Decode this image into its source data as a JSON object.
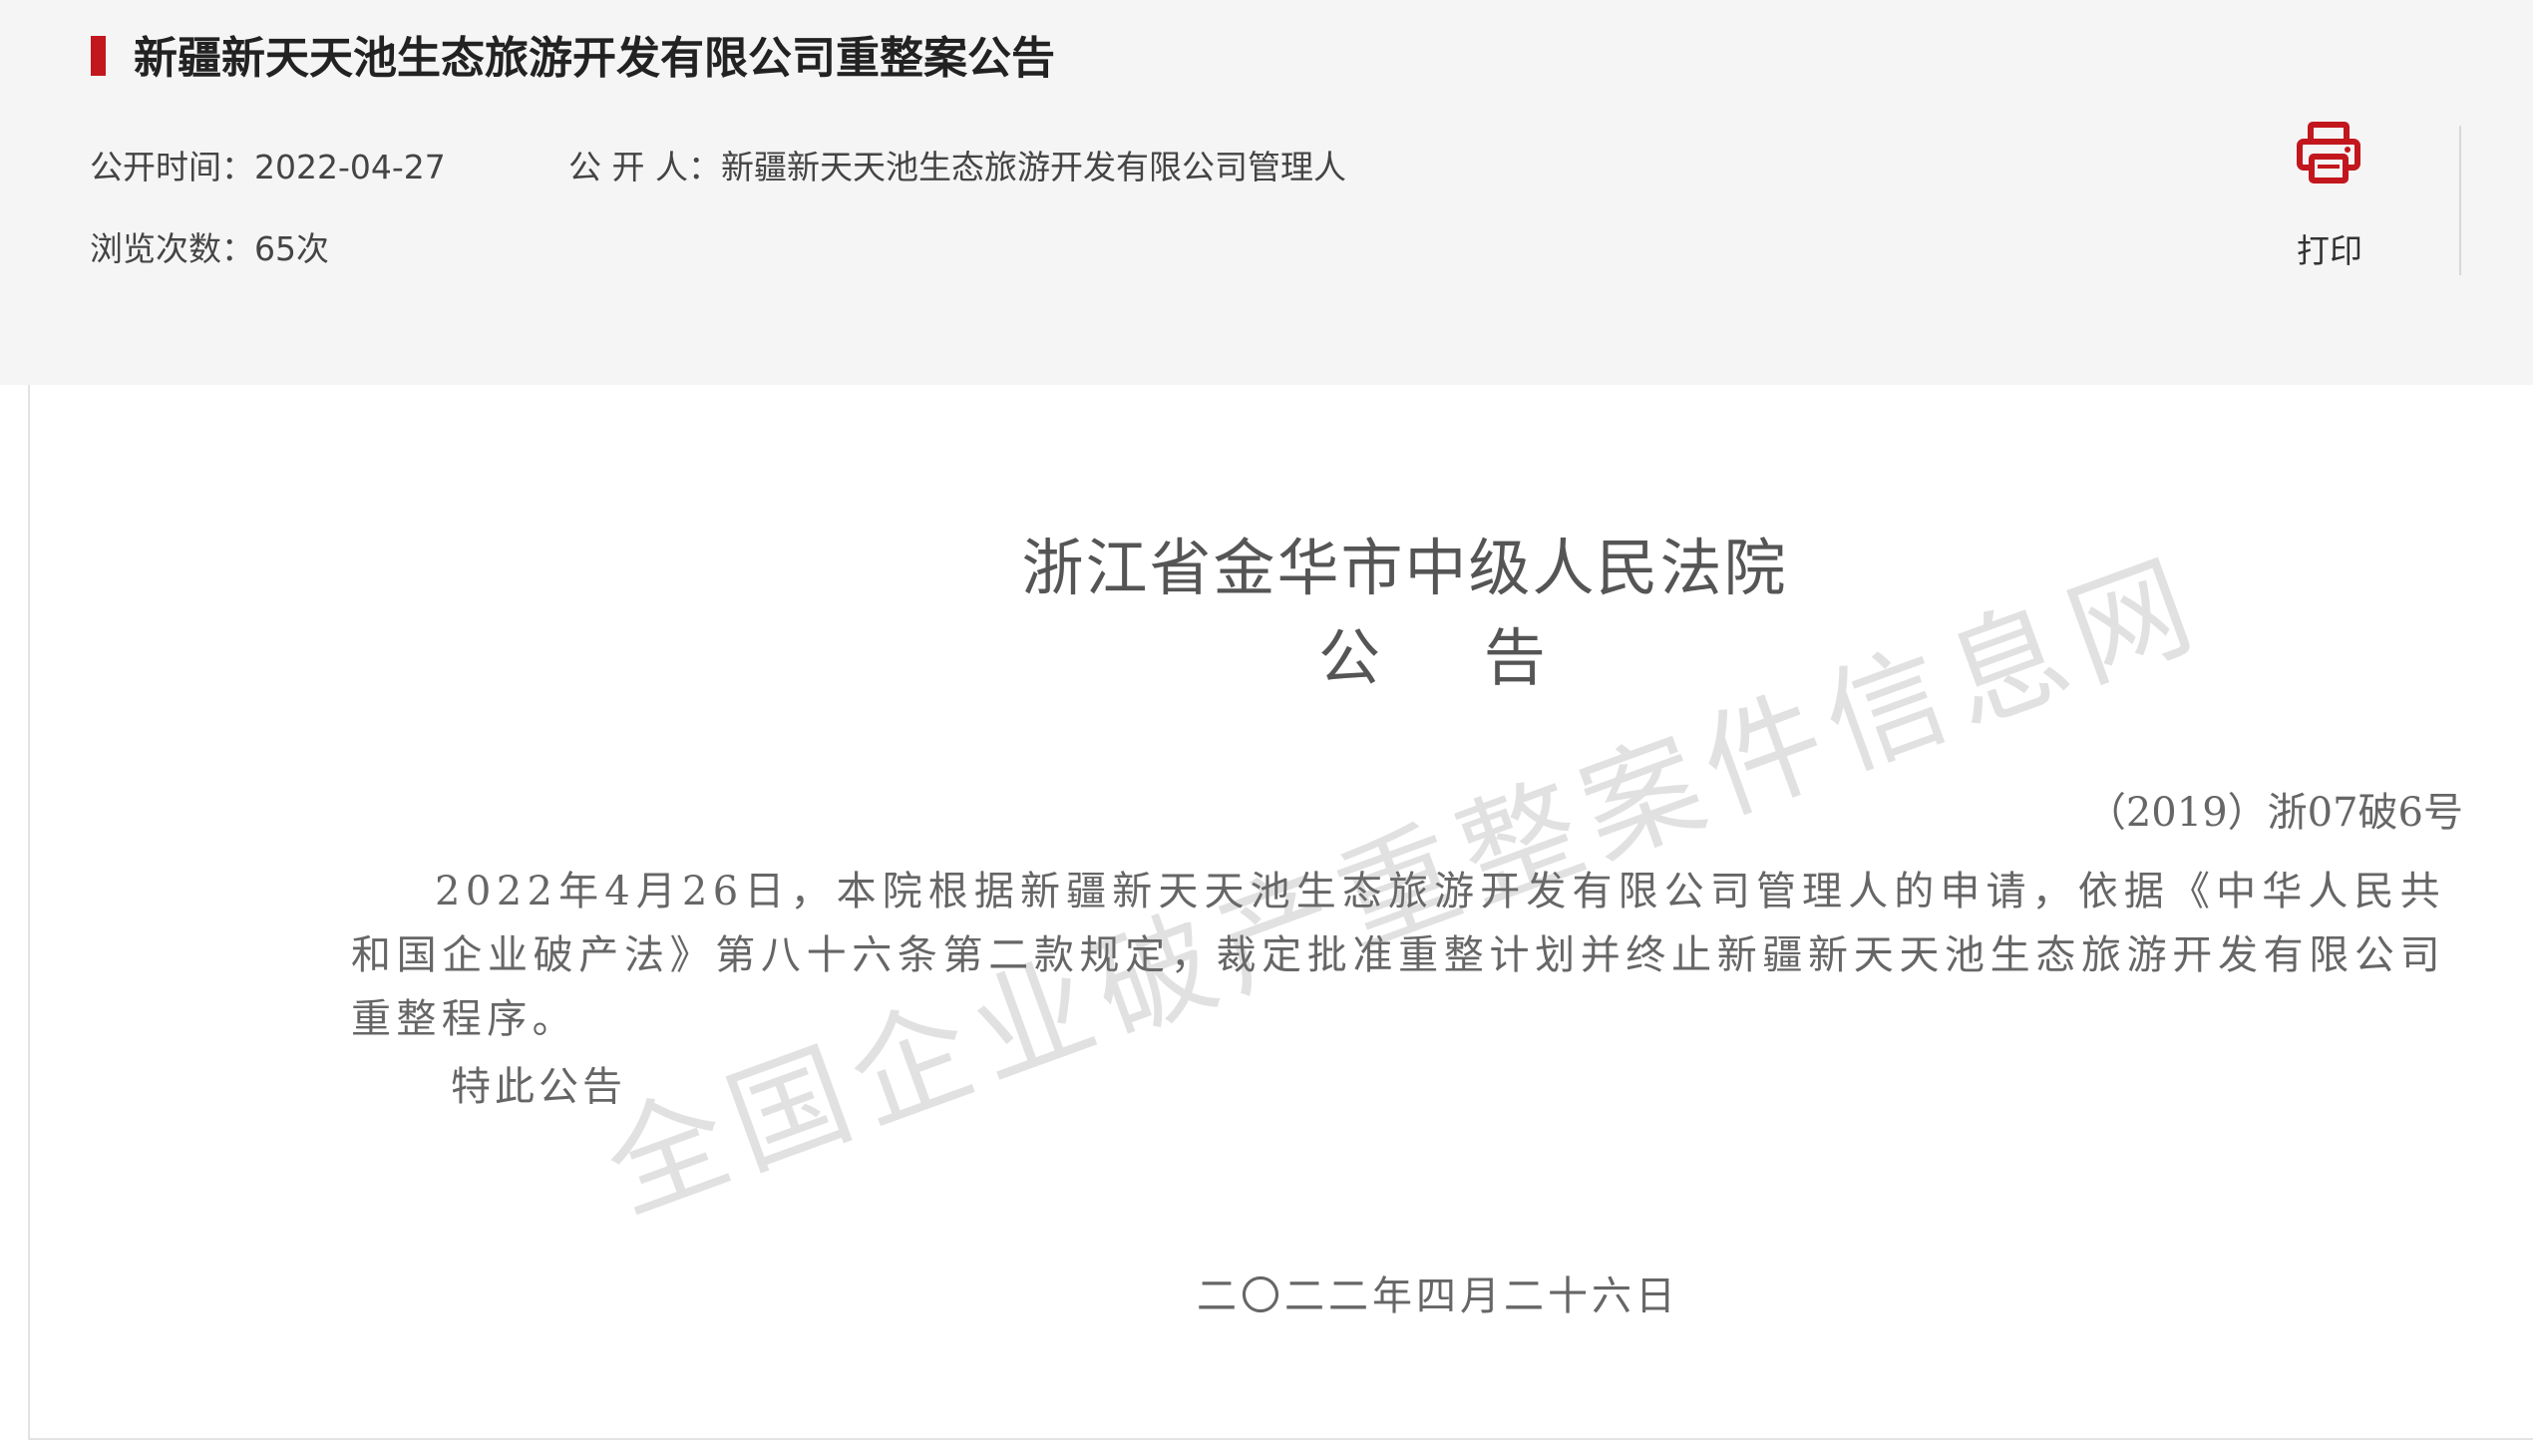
{
  "header": {
    "title": "新疆新天天池生态旅游开发有限公司重整案公告",
    "publish_time_label": "公开时间：",
    "publish_time": "2022-04-27",
    "publisher_label": "公 开 人：",
    "publisher": "新疆新天天池生态旅游开发有限公司管理人",
    "views_label": "浏览次数：",
    "views": "65次",
    "print_label": "打印",
    "accent_color": "#c2171d"
  },
  "document": {
    "court": "浙江省金华市中级人民法院",
    "heading": "公 告",
    "case_number": "（2019）浙07破6号",
    "body": "2022年4月26日，本院根据新疆新天天池生态旅游开发有限公司管理人的申请，依据《中华人民共和国企业破产法》第八十六条第二款规定，裁定批准重整计划并终止新疆新天天池生态旅游开发有限公司重整程序。",
    "closing": "特此公告",
    "date": "二〇二二年四月二十六日"
  },
  "watermark": {
    "text": "全国企业破产重整案件信息网"
  }
}
